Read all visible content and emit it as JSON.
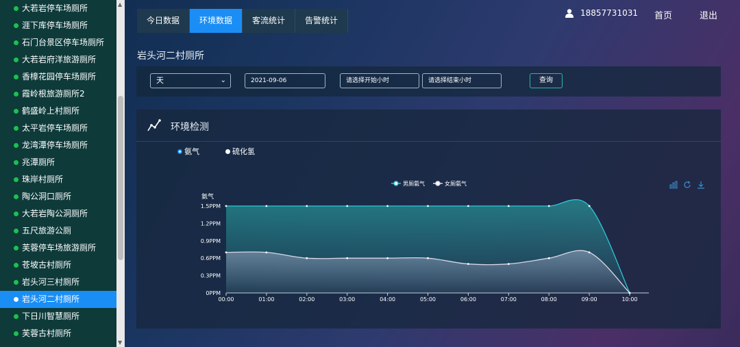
{
  "sidebar": {
    "items": [
      {
        "label": "大若岩停车场厕所",
        "active": false
      },
      {
        "label": "涯下库停车场厕所",
        "active": false
      },
      {
        "label": "石门台景区停车场厕所",
        "active": false
      },
      {
        "label": "大若岩府洋旅游厕所",
        "active": false
      },
      {
        "label": "香樟花园停车场厕所",
        "active": false
      },
      {
        "label": "霞岭根旅游厕所2",
        "active": false
      },
      {
        "label": "鹤盛岭上村厕所",
        "active": false
      },
      {
        "label": "太平岩停车场厕所",
        "active": false
      },
      {
        "label": "龙湾潭停车场厕所",
        "active": false
      },
      {
        "label": "兆潭厕所",
        "active": false
      },
      {
        "label": "珠岸村厕所",
        "active": false
      },
      {
        "label": "陶公洞口厕所",
        "active": false
      },
      {
        "label": "大若岩陶公洞厕所",
        "active": false
      },
      {
        "label": "五尺旅游公厕",
        "active": false
      },
      {
        "label": "芙蓉停车场旅游厕所",
        "active": false
      },
      {
        "label": "苍坡古村厕所",
        "active": false
      },
      {
        "label": "岩头河三村厕所",
        "active": false
      },
      {
        "label": "岩头河二村厕所",
        "active": true
      },
      {
        "label": "下日川智慧厕所",
        "active": false
      },
      {
        "label": "芙蓉古村厕所",
        "active": false
      }
    ]
  },
  "tabs": [
    {
      "label": "今日数据",
      "active": false
    },
    {
      "label": "环境数据",
      "active": true
    },
    {
      "label": "客流统计",
      "active": false
    },
    {
      "label": "告警统计",
      "active": false
    }
  ],
  "header": {
    "user_phone": "18857731031",
    "home_label": "首页",
    "logout_label": "退出"
  },
  "page_title": "岩头河二村厕所",
  "filters": {
    "unit_value": "天",
    "date_value": "2021-09-06",
    "start_hour_placeholder": "请选择开始小时",
    "end_hour_placeholder": "请选择结束小时",
    "query_label": "查询"
  },
  "panel": {
    "title": "环境检测",
    "radios": [
      {
        "label": "氨气",
        "checked": true
      },
      {
        "label": "硫化氢",
        "checked": false
      }
    ]
  },
  "colors": {
    "accent": "#1a8ef5",
    "sidebar_dot": "#19c24f",
    "series_male": "#2cc6d6",
    "series_female": "#d8d8e8"
  },
  "chart_data": {
    "type": "area",
    "ylabel": "氨气",
    "categories": [
      "00:00",
      "01:00",
      "02:00",
      "03:00",
      "04:00",
      "05:00",
      "06:00",
      "07:00",
      "08:00",
      "09:00",
      "10:00"
    ],
    "y_ticks": [
      "0PPM",
      "0.3PPM",
      "0.6PPM",
      "0.9PPM",
      "1.2PPM",
      "1.5PPM"
    ],
    "ylim": [
      0,
      1.5
    ],
    "legend_position": "top-center",
    "series": [
      {
        "name": "男厕氨气",
        "values": [
          1.5,
          1.5,
          1.5,
          1.5,
          1.5,
          1.5,
          1.5,
          1.5,
          1.5,
          1.5,
          0
        ]
      },
      {
        "name": "女厕氨气",
        "values": [
          0.7,
          0.7,
          0.6,
          0.6,
          0.6,
          0.6,
          0.5,
          0.5,
          0.6,
          0.7,
          0
        ]
      }
    ]
  }
}
